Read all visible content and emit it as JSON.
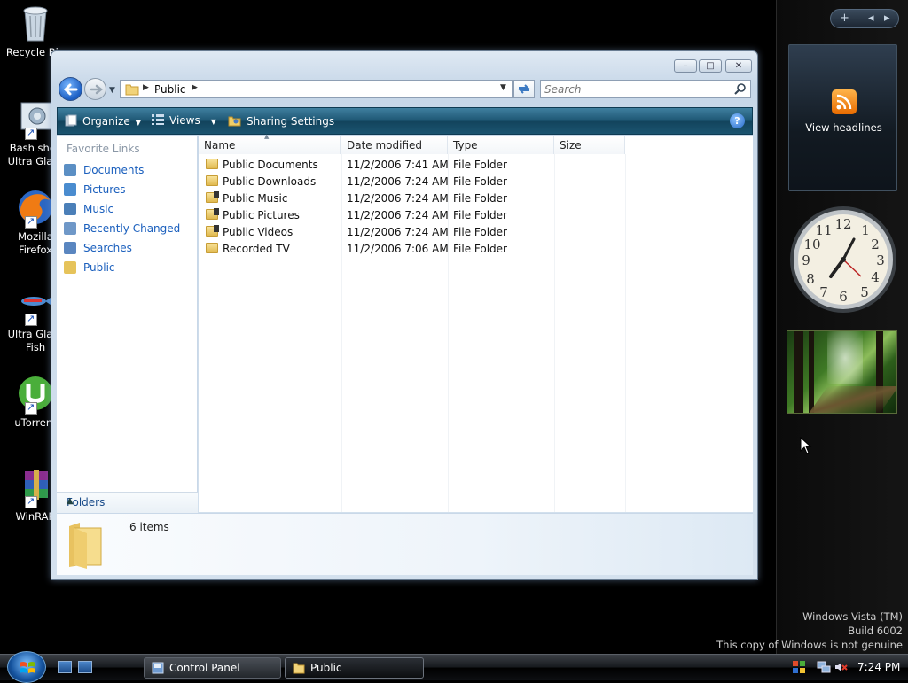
{
  "desktop": {
    "icons": [
      {
        "label": "Recycle Bin",
        "icon": "recycle-bin-icon"
      },
      {
        "label": "Bash shell\nUltra Glass",
        "icon": "settings-shortcut-icon"
      },
      {
        "label": "Mozilla\nFirefox",
        "icon": "firefox-icon"
      },
      {
        "label": "Ultra Glass\nFish",
        "icon": "fish-icon"
      },
      {
        "label": "uTorrent",
        "icon": "utorrent-icon"
      },
      {
        "label": "WinRAR",
        "icon": "winrar-icon"
      }
    ],
    "watermark": {
      "line1": "Windows Vista (TM)",
      "line2": "Build 6002",
      "line3": "This copy of Windows is not genuine"
    }
  },
  "sidebar": {
    "feed": {
      "label": "View headlines"
    },
    "controls": {
      "add": "+",
      "prev": "◂",
      "next": "▸"
    }
  },
  "window": {
    "caption": {
      "min": "–",
      "max": "□",
      "close": "✕"
    },
    "address": {
      "segment": "Public"
    },
    "search": {
      "placeholder": "Search"
    },
    "toolbar": {
      "organize": "Organize",
      "views": "Views",
      "sharing": "Sharing Settings",
      "help": "?"
    },
    "nav_pane": {
      "header": "Favorite Links",
      "links": [
        {
          "label": "Documents",
          "color": "#5b8fc4"
        },
        {
          "label": "Pictures",
          "color": "#4a8ccf"
        },
        {
          "label": "Music",
          "color": "#4b7fb8"
        },
        {
          "label": "Recently Changed",
          "color": "#6f98c8"
        },
        {
          "label": "Searches",
          "color": "#5a86c0"
        },
        {
          "label": "Public",
          "color": "#e6c35a"
        }
      ],
      "folders_label": "Folders"
    },
    "columns": {
      "name": "Name",
      "date": "Date modified",
      "type": "Type",
      "size": "Size"
    },
    "files": [
      {
        "name": "Public Documents",
        "date": "11/2/2006 7:41 AM",
        "type": "File Folder",
        "size": ""
      },
      {
        "name": "Public Downloads",
        "date": "11/2/2006 7:24 AM",
        "type": "File Folder",
        "size": ""
      },
      {
        "name": "Public Music",
        "date": "11/2/2006 7:24 AM",
        "type": "File Folder",
        "size": ""
      },
      {
        "name": "Public Pictures",
        "date": "11/2/2006 7:24 AM",
        "type": "File Folder",
        "size": ""
      },
      {
        "name": "Public Videos",
        "date": "11/2/2006 7:24 AM",
        "type": "File Folder",
        "size": ""
      },
      {
        "name": "Recorded TV",
        "date": "11/2/2006 7:06 AM",
        "type": "File Folder",
        "size": ""
      }
    ],
    "details": {
      "count": "6 items"
    }
  },
  "taskbar": {
    "buttons": [
      {
        "label": "Control Panel"
      },
      {
        "label": "Public"
      }
    ],
    "clock": "7:24 PM"
  }
}
